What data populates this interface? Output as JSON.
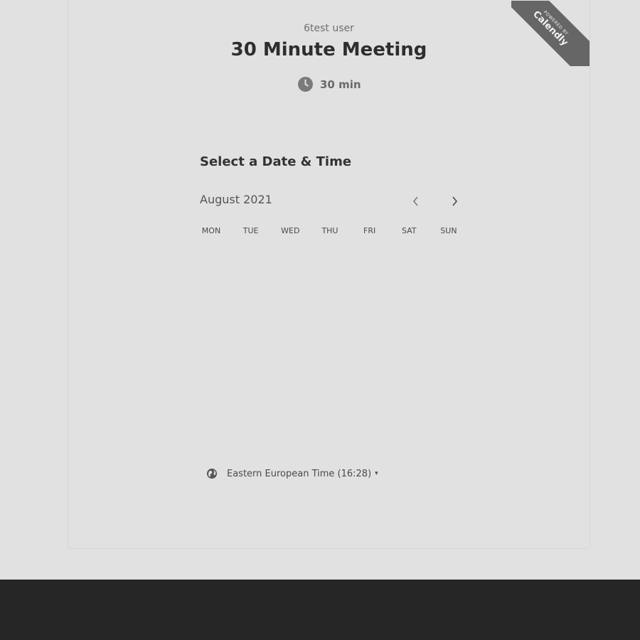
{
  "ribbon": {
    "line1": "POWERED BY",
    "brand": "Calendly"
  },
  "event": {
    "host": "6test user",
    "title": "30 Minute Meeting",
    "duration": "30 min",
    "duration_icon": "clock-icon"
  },
  "scheduler": {
    "heading": "Select a Date & Time",
    "month": "August 2021",
    "prev_icon": "chevron-left-icon",
    "next_icon": "chevron-right-icon",
    "weekdays": [
      "MON",
      "TUE",
      "WED",
      "THU",
      "FRI",
      "SAT",
      "SUN"
    ]
  },
  "timezone": {
    "icon": "globe-icon",
    "label": "Eastern European Time (16:28)",
    "caret": "▾"
  },
  "colors": {
    "background": "#e1e1e1",
    "footer": "#262626",
    "ribbon": "#666666"
  }
}
